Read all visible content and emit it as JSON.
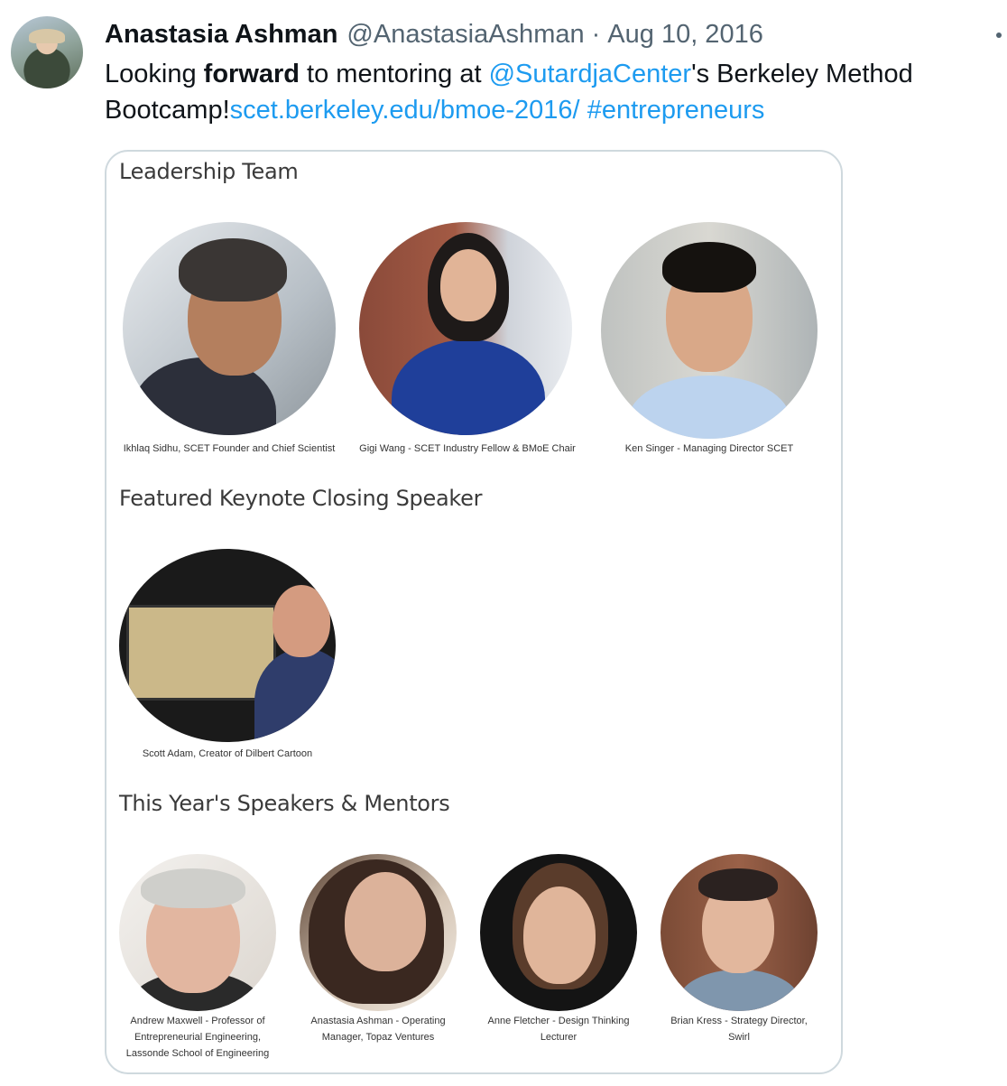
{
  "tweet": {
    "author_name": "Anastasia Ashman",
    "author_handle": "@AnastasiaAshman",
    "separator": "·",
    "date": "Aug 10, 2016",
    "text": {
      "part1": "Looking ",
      "bold": "forward",
      "part2": " to mentoring at ",
      "mention": "@SutardjaCenter",
      "part3": "'s Berkeley Method Bootcamp!",
      "link": "scet.berkeley.edu/bmoe-2016/",
      "space": " ",
      "hashtag": "#entrepreneurs"
    }
  },
  "card": {
    "sections": {
      "leadership": "Leadership Team",
      "keynote": "Featured Keynote Closing Speaker",
      "speakers": "This Year's Speakers & Mentors"
    },
    "people": {
      "ikhlaq": "Ikhlaq Sidhu, SCET Founder and Chief Scientist",
      "gigi": "Gigi Wang - SCET Industry Fellow & BMoE Chair",
      "ken": "Ken Singer - Managing Director SCET",
      "scott": "Scott Adam, Creator of Dilbert Cartoon",
      "andrew_1": "Andrew Maxwell - Professor of",
      "andrew_2": "Entrepreneurial Engineering,",
      "andrew_3": "Lassonde School of Engineering",
      "anastasia_1": "Anastasia Ashman - Operating",
      "anastasia_2": "Manager, Topaz Ventures",
      "anne_1": "Anne Fletcher - Design Thinking",
      "anne_2": "Lecturer",
      "brian_1": "Brian Kress - Strategy Director,",
      "brian_2": "Swirl"
    }
  },
  "colors": {
    "link": "#1d9bf0",
    "secondary_text": "#536471",
    "card_border": "#cfd9de"
  }
}
